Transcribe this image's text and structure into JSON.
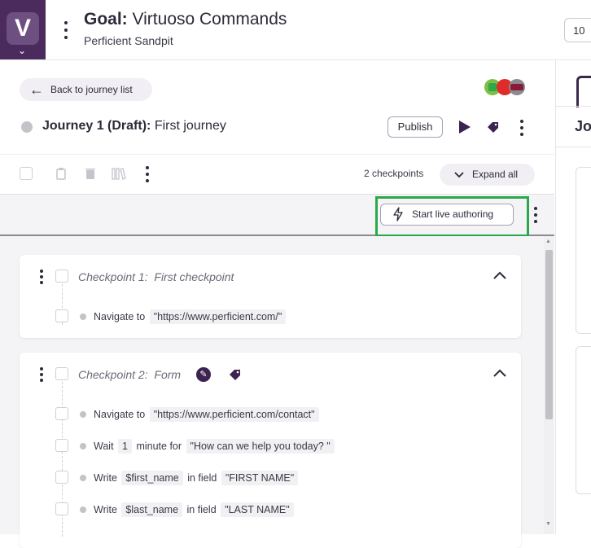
{
  "header": {
    "logo_letter": "V",
    "goal_label": "Goal:",
    "goal_name": "Virtuoso Commands",
    "project": "Perficient Sandpit",
    "right_box_text": "10"
  },
  "right_panel": {
    "title_fragment": "Jo"
  },
  "journey": {
    "back_label": "Back to journey list",
    "title_label": "Journey 1 (Draft):",
    "title_name": "First journey",
    "publish_label": "Publish",
    "avatar_colors": [
      "#7bc043",
      "#e02b2b",
      "#8a1a3a",
      "#9a9a9e"
    ]
  },
  "toolbar": {
    "checkpoints_count": "2 checkpoints",
    "expand_all_label": "Expand all"
  },
  "live_authoring": {
    "button_label": "Start live authoring",
    "highlight_color": "#2aa84a"
  },
  "checkpoints": [
    {
      "label": "Checkpoint 1:",
      "name": "First checkpoint",
      "steps": [
        {
          "verb": "Navigate to",
          "value": "\"https://www.perficient.com/\""
        }
      ]
    },
    {
      "label": "Checkpoint 2:",
      "name": "Form",
      "steps": [
        {
          "verb": "Navigate to",
          "value": "\"https://www.perficient.com/contact\""
        },
        {
          "verb": "Wait",
          "num": "1",
          "unit": "minute for",
          "value": "\"How can we help you today? \""
        },
        {
          "verb": "Write",
          "var": "$first_name",
          "mid": "in field",
          "value": "\"FIRST NAME\""
        },
        {
          "verb": "Write",
          "var": "$last_name",
          "mid": "in field",
          "value": "\"LAST NAME\""
        }
      ]
    }
  ]
}
